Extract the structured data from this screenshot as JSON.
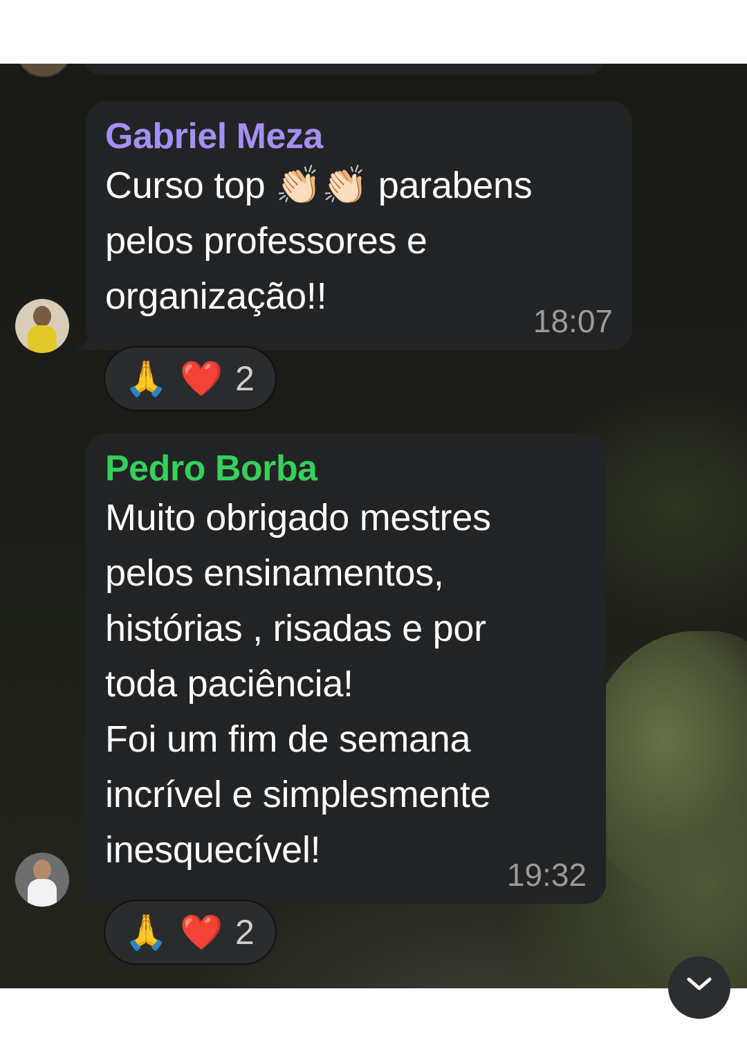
{
  "messages": [
    {
      "sender": "Gabriel Meza",
      "sender_color": "#a48ff5",
      "text": "Curso top 👏🏻👏🏻 parabens\npelos professores e\norganização!!",
      "time": "18:07",
      "reactions": {
        "emoji_1": "🙏",
        "emoji_2": "❤️",
        "count": "2"
      }
    },
    {
      "sender": "Pedro Borba",
      "sender_color": "#35d05a",
      "text": "Muito obrigado mestres\npelos ensinamentos,\nhistórias , risadas e por\ntoda paciência!\nFoi um fim de semana\nincrível e simplesmente\ninesquecível!",
      "time": "19:32",
      "reactions": {
        "emoji_1": "🙏",
        "emoji_2": "❤️",
        "count": "2"
      }
    }
  ],
  "icons": {
    "scroll_down": "chevron-down-icon"
  }
}
